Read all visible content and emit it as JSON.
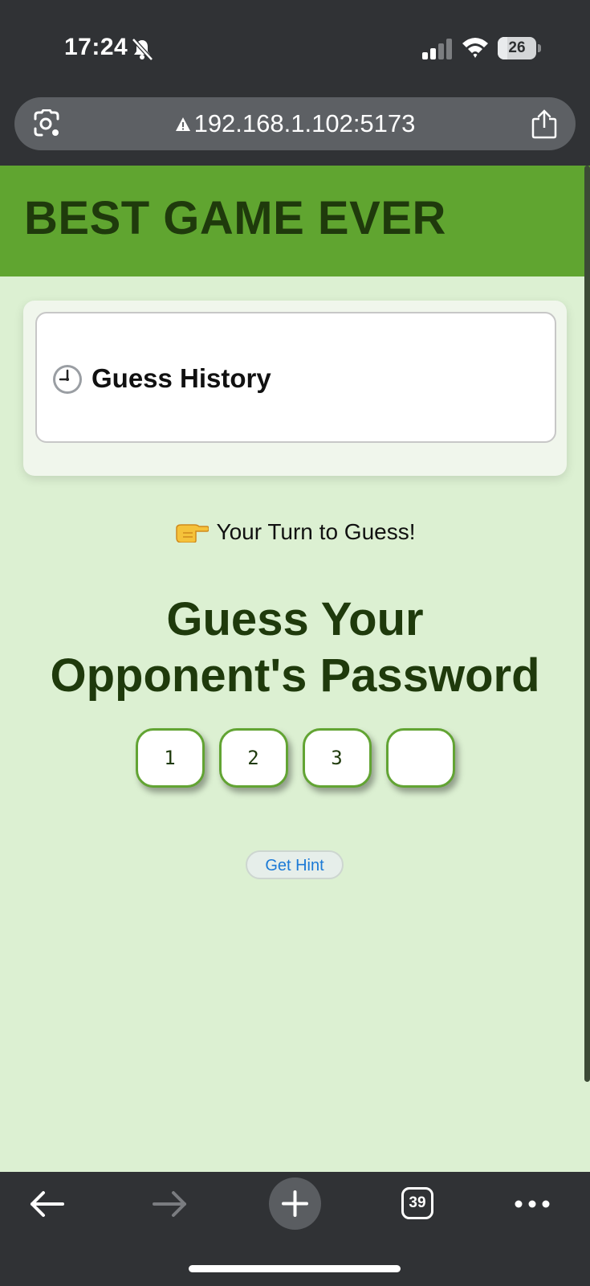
{
  "status_bar": {
    "time": "17:24",
    "battery_level": "26",
    "battery_fraction": 0.26,
    "icons": [
      "bell-slash-icon",
      "signal-icon",
      "wifi-icon",
      "battery-icon"
    ]
  },
  "browser": {
    "url": "192.168.1.102:5173",
    "icons": [
      "lens-icon",
      "warning-icon",
      "share-icon"
    ],
    "tab_count": "39"
  },
  "page": {
    "title": "BEST GAME EVER",
    "history": {
      "title": "Guess History",
      "icon": "clock-icon"
    },
    "turn_text": "Your Turn to Guess!",
    "turn_icon": "pointing-right-icon",
    "guess_title_line1": "Guess Your",
    "guess_title_line2": "Opponent's Password",
    "digits": [
      "1",
      "2",
      "3",
      ""
    ],
    "hint_label": "Get Hint"
  },
  "colors": {
    "header_green": "#60a530",
    "page_background": "#dcf0d2",
    "title_text": "#1f3a0c",
    "digit_border": "#62a433",
    "hint_text": "#1c7ad6",
    "chrome": "#303235"
  }
}
